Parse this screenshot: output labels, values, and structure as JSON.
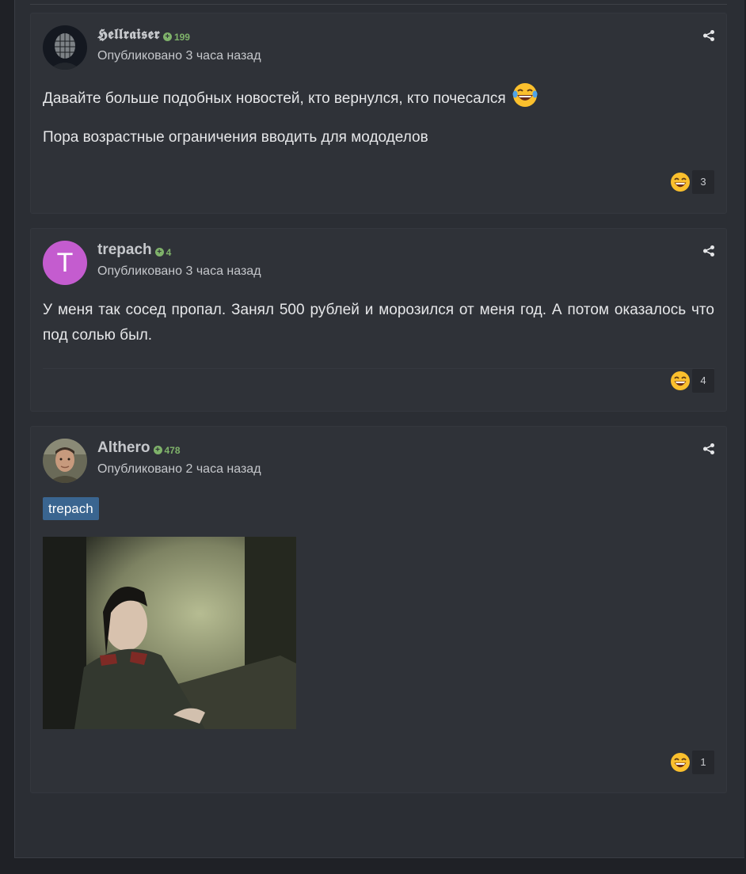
{
  "posts": [
    {
      "author": "𝕳𝖊𝖑𝖑𝖗𝖆𝖎𝖘𝖊𝖗",
      "reputation": "199",
      "posted": "Опубликовано 3 часа назад",
      "paragraphs": [
        "Давайте больше подобных новостей, кто вернулся, кто почесался",
        "Пора возрастные ограничения вводить для мододелов"
      ],
      "reaction_count": "3"
    },
    {
      "author": "trepach",
      "avatar_letter": "T",
      "reputation": "4",
      "posted": "Опубликовано 3 часа назад",
      "paragraphs": [
        "У меня так сосед пропал. Занял 500 рублей и морозился от меня год. А потом оказалось что под солью был."
      ],
      "reaction_count": "4"
    },
    {
      "author": "Althero",
      "reputation": "478",
      "posted": "Опубликовано 2 часа назад",
      "mention": "trepach",
      "reaction_count": "1"
    }
  ],
  "colors": {
    "page_bg": "#2b2e34",
    "post_bg": "#2f3238",
    "reputation": "#7fb26a",
    "mention_bg": "#3a6590",
    "avatar_trepach": "#c45ccf"
  },
  "icons": {
    "reputation": "plus-circle-icon",
    "share": "share-icon",
    "reaction": "grin-emoji-icon",
    "inline_emoji": "laughing-tears-emoji-icon"
  }
}
